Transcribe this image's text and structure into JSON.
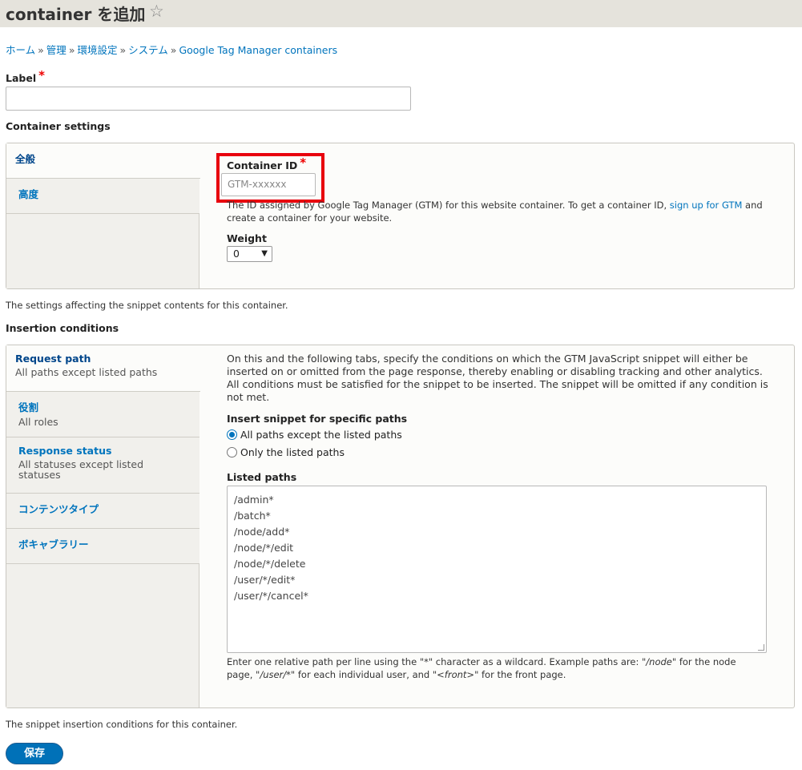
{
  "header": {
    "title": "container を追加",
    "star_icon": "star-outline-icon"
  },
  "breadcrumb": [
    "ホーム",
    "管理",
    "環境設定",
    "システム",
    "Google Tag Manager containers"
  ],
  "breadcrumb_separator": "»",
  "label_field": {
    "label": "Label",
    "required_mark": "*",
    "value": ""
  },
  "container_settings": {
    "title": "Container settings",
    "tabs": [
      {
        "label": "全般",
        "summary": ""
      },
      {
        "label": "高度",
        "summary": ""
      }
    ],
    "container_id": {
      "label": "Container ID",
      "required_mark": "*",
      "placeholder": "GTM-xxxxxx",
      "description_before": "The ID assigned by Google Tag Manager (GTM) for this website container. To get a container ID, ",
      "description_link": "sign up for GTM",
      "description_after": " and create a container for your website."
    },
    "weight": {
      "label": "Weight",
      "value": "0"
    },
    "description": "The settings affecting the snippet contents for this container."
  },
  "insertion_conditions": {
    "title": "Insertion conditions",
    "tabs": [
      {
        "label": "Request path",
        "summary": "All paths except listed paths"
      },
      {
        "label": "役割",
        "summary": "All roles"
      },
      {
        "label": "Response status",
        "summary": "All statuses except listed statuses"
      },
      {
        "label": "コンテンツタイプ",
        "summary": ""
      },
      {
        "label": "ボキャブラリー",
        "summary": ""
      }
    ],
    "intro": "On this and the following tabs, specify the conditions on which the GTM JavaScript snippet will either be inserted on or omitted from the page response, thereby enabling or disabling tracking and other analytics. All conditions must be satisfied for the snippet to be inserted. The snippet will be omitted if any condition is not met.",
    "insert_snippet_label": "Insert snippet for specific paths",
    "radio_options": [
      "All paths except the listed paths",
      "Only the listed paths"
    ],
    "radio_selected": 0,
    "listed_paths_label": "Listed paths",
    "listed_paths": [
      "/admin*",
      "/batch*",
      "/node/add*",
      "/node/*/edit",
      "/node/*/delete",
      "/user/*/edit*",
      "/user/*/cancel*"
    ],
    "help_part1": "Enter one relative path per line using the \"*\" character as a wildcard. Example paths are: \"",
    "help_ex1": "/node",
    "help_part2": "\" for the node page, \"",
    "help_ex2": "/user/*",
    "help_part3": "\" for each individual user, and \"",
    "help_ex3": "<front>",
    "help_part4": "\" for the front page.",
    "description": "The snippet insertion conditions for this container."
  },
  "actions": {
    "save_label": "保存"
  }
}
